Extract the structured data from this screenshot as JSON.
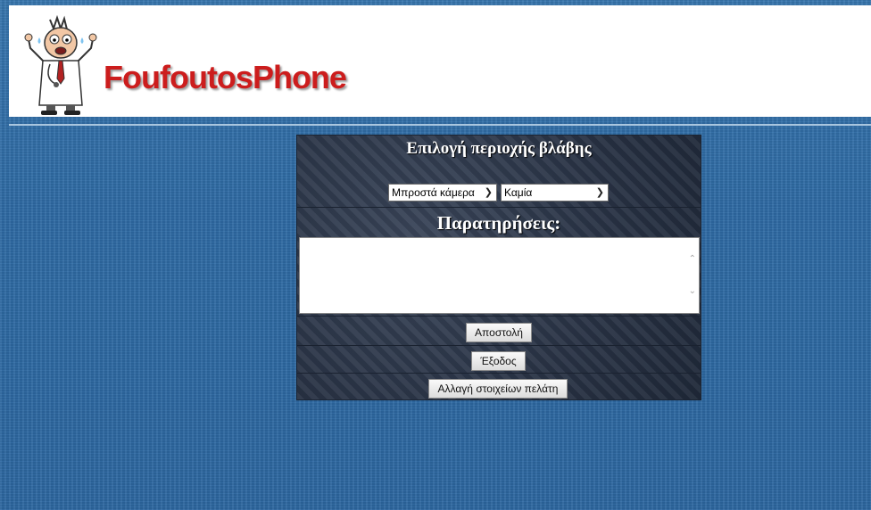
{
  "header": {
    "brand": "FoufoutosPhone",
    "logo_icon": "cartoon-doctor-icon"
  },
  "form": {
    "title": "Επιλογή περιοχής βλάβης",
    "area_select": {
      "selected": "Μπροστά κάμερα"
    },
    "issue_select": {
      "selected": "Καμία"
    },
    "notes_label": "Παρατηρήσεις:",
    "notes_value": "",
    "buttons": {
      "submit": "Αποστολή",
      "exit": "Έξοδος",
      "change_customer": "Αλλαγή στοιχείων πελάτη"
    }
  },
  "colors": {
    "brand": "#cc1d1d",
    "page_background": "#2f6ea6",
    "panel_background": "#283244"
  }
}
